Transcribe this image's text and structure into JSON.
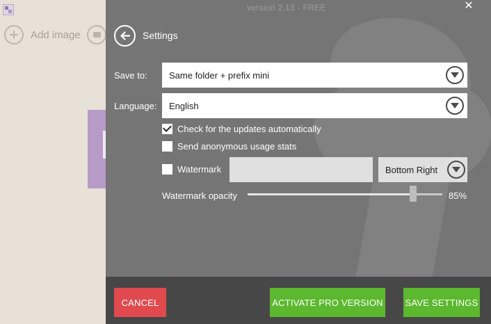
{
  "window": {
    "version": "version 2.13 - FREE"
  },
  "toolbar": {
    "add_image_label": "Add image"
  },
  "settings": {
    "title": "Settings",
    "save_to": {
      "label": "Save to:",
      "value": "Same folder + prefix mini"
    },
    "language": {
      "label": "Language:",
      "value": "English"
    },
    "check_updates": {
      "label": "Check for the updates automatically",
      "checked": true
    },
    "usage_stats": {
      "label": "Send anonymous usage stats",
      "checked": false
    },
    "watermark": {
      "label": "Watermark",
      "checked": false,
      "text_value": "",
      "position": "Bottom Right"
    },
    "watermark_opacity": {
      "label": "Watermark opacity",
      "value": 85,
      "value_text": "85%"
    }
  },
  "footer": {
    "cancel_label": "CANCEL",
    "activate_label": "ACTIVATE PRO VERSION",
    "save_label": "SAVE SETTINGS"
  },
  "colors": {
    "panel_bg": "#757575",
    "footer_bg": "#474747",
    "cancel": "#e04a4f",
    "accent_green": "#5cb82e"
  },
  "icons": [
    "app-icon",
    "add-icon",
    "folder-icon",
    "back-arrow-icon",
    "close-icon",
    "chevron-down-icon",
    "checkmark-icon"
  ]
}
